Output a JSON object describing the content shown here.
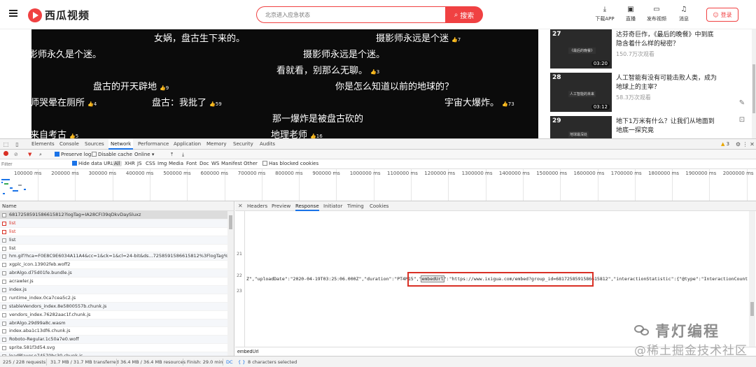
{
  "header": {
    "logo": "西瓜视频",
    "search_placeholder": "北京进入应急状态",
    "search_button": "搜索",
    "actions": [
      "下载APP",
      "直播",
      "发布视频",
      "消息"
    ],
    "login": "登录"
  },
  "danmaku": [
    {
      "text": "女娲，盘古生下来的。",
      "likes": ""
    },
    {
      "text": "摄影师永远是个迷",
      "likes": "7"
    },
    {
      "text": "影师永久是个迷。",
      "likes": ""
    },
    {
      "text": "摄影师永远是个迷。",
      "likes": ""
    },
    {
      "text": "看就看，别那么无聊。",
      "likes": "3"
    },
    {
      "text": "盘古的开天辟地",
      "likes": "9"
    },
    {
      "text": "你是怎么知道以前的地球的？",
      "likes": ""
    },
    {
      "text": "师哭晕在厕所",
      "likes": "4"
    },
    {
      "text": "盘古：我批了",
      "likes": "59"
    },
    {
      "text": "宇宙大爆炸。",
      "likes": "73"
    },
    {
      "text": "那一爆炸是被盘古砍的",
      "likes": ""
    },
    {
      "text": "来自考古",
      "likes": "5"
    },
    {
      "text": "地理老师",
      "likes": "16"
    }
  ],
  "recommendations": [
    {
      "rank": "27",
      "title": "达芬奇巨作，《最后的晚餐》中到底隐含着什么样的秘密？",
      "views": "150.7万次观看",
      "duration": "03:20",
      "thumb_label": "《最后的晚餐》"
    },
    {
      "rank": "28",
      "title": "人工智能有没有可能击败人类，成为地球上的主宰？",
      "views": "58.3万次观看",
      "duration": "03:12",
      "thumb_label": "人工智能的未来"
    },
    {
      "rank": "29",
      "title": "地下1万米有什么？让我们从地面到地底一探究竟",
      "views": "",
      "duration": "",
      "thumb_label": "地球最深处"
    }
  ],
  "devtools": {
    "tabs": [
      "Elements",
      "Console",
      "Sources",
      "Network",
      "Performance",
      "Application",
      "Memory",
      "Security",
      "Audits"
    ],
    "active_tab": "Network",
    "warnings": "3",
    "toolbar": {
      "preserve_log": "Preserve log",
      "disable_cache": "Disable cache",
      "throttle": "Online"
    },
    "filter": {
      "placeholder": "Filter",
      "hide_data_urls": "Hide data URLs",
      "types": [
        "All",
        "XHR",
        "JS",
        "CSS",
        "Img",
        "Media",
        "Font",
        "Doc",
        "WS",
        "Manifest",
        "Other"
      ],
      "blocked": "Has blocked cookies"
    },
    "timeline_ticks": [
      "100000 ms",
      "200000 ms",
      "300000 ms",
      "400000 ms",
      "500000 ms",
      "600000 ms",
      "700000 ms",
      "800000 ms",
      "900000 ms",
      "1000000 ms",
      "1100000 ms",
      "1200000 ms",
      "1300000 ms",
      "1400000 ms",
      "1500000 ms",
      "1600000 ms",
      "1700000 ms",
      "1800000 ms",
      "1900000 ms",
      "2000000 ms"
    ],
    "name_header": "Name",
    "requests": [
      {
        "name": "6817258591586615812?logTag=IA28CFI39qDkvDaySluxz",
        "error": false,
        "selected": true
      },
      {
        "name": "list",
        "error": true,
        "selected": false
      },
      {
        "name": "list",
        "error": true,
        "selected": false
      },
      {
        "name": "list",
        "error": false,
        "selected": false
      },
      {
        "name": "list",
        "error": false,
        "selected": false
      },
      {
        "name": "hm.gif?hca=F0E8C9E6034A11A4&cc=1&ck=1&cl=24-bit&ds...7258591586615812%3FlogTag%3DIA28CF",
        "error": false,
        "selected": false
      },
      {
        "name": "xgplc_icon.13902feb.woff2",
        "error": false,
        "selected": false
      },
      {
        "name": "abrAlgo.d75d01fe.bundle.js",
        "error": false,
        "selected": false
      },
      {
        "name": "acrawler.js",
        "error": false,
        "selected": false
      },
      {
        "name": "index.js",
        "error": false,
        "selected": false
      },
      {
        "name": "runtime_index.0ca7cea5c2.js",
        "error": false,
        "selected": false
      },
      {
        "name": "stableVendors_index.8e5800557b.chunk.js",
        "error": false,
        "selected": false
      },
      {
        "name": "vendors_index.76282aac1f.chunk.js",
        "error": false,
        "selected": false
      },
      {
        "name": "abrAlgo.29d99a8c.wasm",
        "error": false,
        "selected": false
      },
      {
        "name": "index.aba1c13df6.chunk.js",
        "error": false,
        "selected": false
      },
      {
        "name": "Roboto-Regular.1c50a7e0.woff",
        "error": false,
        "selected": false
      },
      {
        "name": "sprite.581f3d54.svg",
        "error": false,
        "selected": false
      },
      {
        "name": "loadPlayer.e74570bc30.chunk.js",
        "error": false,
        "selected": false
      }
    ],
    "detail_tabs": [
      "Headers",
      "Preview",
      "Response",
      "Initiator",
      "Timing",
      "Cookies"
    ],
    "active_detail_tab": "Response",
    "code": [
      {
        "ln": "21",
        "pre": "",
        "hl": "",
        "post": ""
      },
      {
        "ln": "22",
        "pre": "Z\",\"uploadDate\":\"2020-04-19T03:25:06.000Z\",\"duration\":\"PT4M15\",\"",
        "hl": "embedUrl",
        "post": "\":\"https://www.ixigua.com/embed?group_id=6817258591586615812\",\"interactionStatistic\":{\"@type\":\"InteractionCounter\",\"intera"
      },
      {
        "ln": "23",
        "pre": "",
        "hl": "",
        "post": ""
      }
    ],
    "search_value": "embedUrl",
    "status": {
      "requests": "225 / 228 requests",
      "transferred": "31.7 MB / 31.7 MB transferred",
      "resources": "36.4 MB / 36.4 MB resources",
      "finish": "Finish: 29.0 min",
      "dc": "DC",
      "matches": "8 characters selected"
    }
  },
  "watermark": {
    "brand": "青灯编程",
    "site": "@稀土掘金技术社区"
  }
}
